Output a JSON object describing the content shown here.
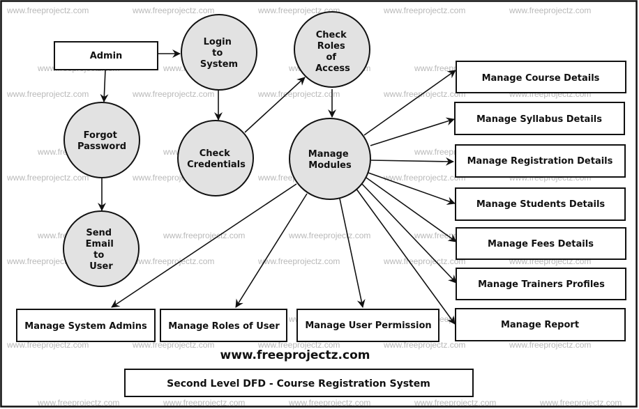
{
  "diagram": {
    "type": "Second Level Data Flow Diagram",
    "title": "Second Level DFD - Course Registration System",
    "website": "www.freeprojectz.com",
    "watermark": "www.freeprojectz.com",
    "colors": {
      "process_fill": "#e2e2e2",
      "stroke": "#111111",
      "watermark": "#b9b9b9",
      "background": "#ffffff"
    },
    "entities": {
      "admin": "Admin",
      "manage_course": "Manage Course Details",
      "manage_syllabus": "Manage Syllabus Details",
      "manage_registration": "Manage Registration Details",
      "manage_students": "Manage Students Details",
      "manage_fees": "Manage Fees Details",
      "manage_trainers": "Manage Trainers Profiles",
      "manage_report": "Manage Report",
      "manage_system_admins": "Manage System Admins",
      "manage_roles": "Manage Roles of User",
      "manage_permission": "Manage User Permission"
    },
    "processes": {
      "login": [
        "Login",
        "to",
        "System"
      ],
      "check_roles": [
        "Check",
        "Roles",
        "of",
        "Access"
      ],
      "forgot_password": [
        "Forgot",
        "Password"
      ],
      "check_credentials": [
        "Check",
        "Credentials"
      ],
      "manage_modules": [
        "Manage",
        "Modules"
      ],
      "send_email": [
        "Send",
        "Email",
        "to",
        "User"
      ]
    },
    "flows": [
      {
        "from": "Admin",
        "to": "Login to System"
      },
      {
        "from": "Admin",
        "to": "Forgot Password"
      },
      {
        "from": "Forgot Password",
        "to": "Send Email to User"
      },
      {
        "from": "Login to System",
        "to": "Check Credentials"
      },
      {
        "from": "Check Credentials",
        "to": "Check Roles of Access"
      },
      {
        "from": "Check Roles of Access",
        "to": "Manage Modules"
      },
      {
        "from": "Manage Modules",
        "to": "Manage Course Details"
      },
      {
        "from": "Manage Modules",
        "to": "Manage Syllabus Details"
      },
      {
        "from": "Manage Modules",
        "to": "Manage Registration Details"
      },
      {
        "from": "Manage Modules",
        "to": "Manage Students Details"
      },
      {
        "from": "Manage Modules",
        "to": "Manage Fees Details"
      },
      {
        "from": "Manage Modules",
        "to": "Manage Trainers Profiles"
      },
      {
        "from": "Manage Modules",
        "to": "Manage Report"
      },
      {
        "from": "Manage Modules",
        "to": "Manage System Admins"
      },
      {
        "from": "Manage Modules",
        "to": "Manage Roles of User"
      },
      {
        "from": "Manage Modules",
        "to": "Manage User Permission"
      }
    ]
  }
}
